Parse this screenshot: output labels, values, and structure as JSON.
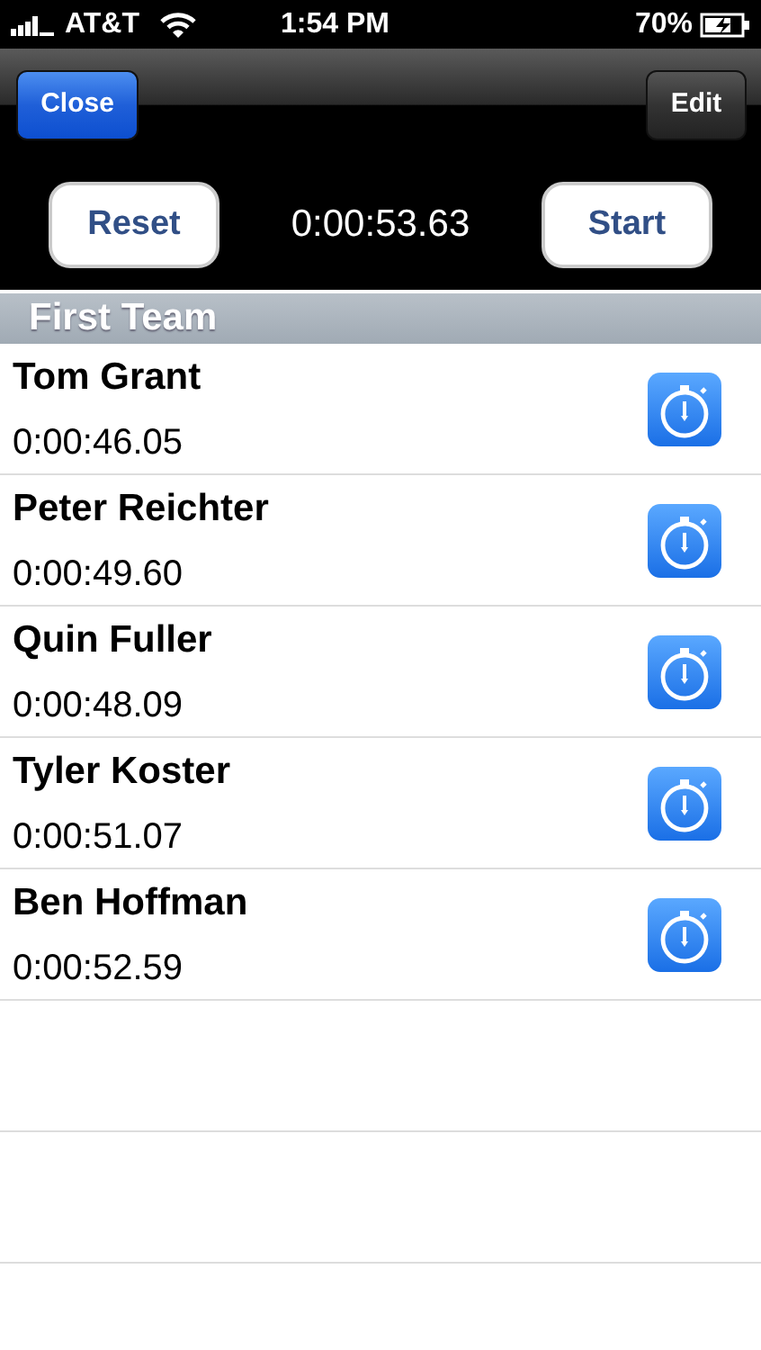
{
  "status_bar": {
    "carrier": "AT&T",
    "time": "1:54 PM",
    "battery": "70%"
  },
  "nav_bar": {
    "left_button": "Close",
    "right_button": "Edit"
  },
  "timer": {
    "reset_button": "Reset",
    "elapsed": "0:00:53.63",
    "start_button": "Start"
  },
  "section": {
    "title": "First Team",
    "rows": [
      {
        "name": "Tom Grant",
        "time": "0:00:46.05"
      },
      {
        "name": "Peter Reichter",
        "time": "0:00:49.60"
      },
      {
        "name": "Quin Fuller",
        "time": "0:00:48.09"
      },
      {
        "name": "Tyler Koster",
        "time": "0:00:51.07"
      },
      {
        "name": "Ben Hoffman",
        "time": "0:00:52.59"
      }
    ]
  }
}
